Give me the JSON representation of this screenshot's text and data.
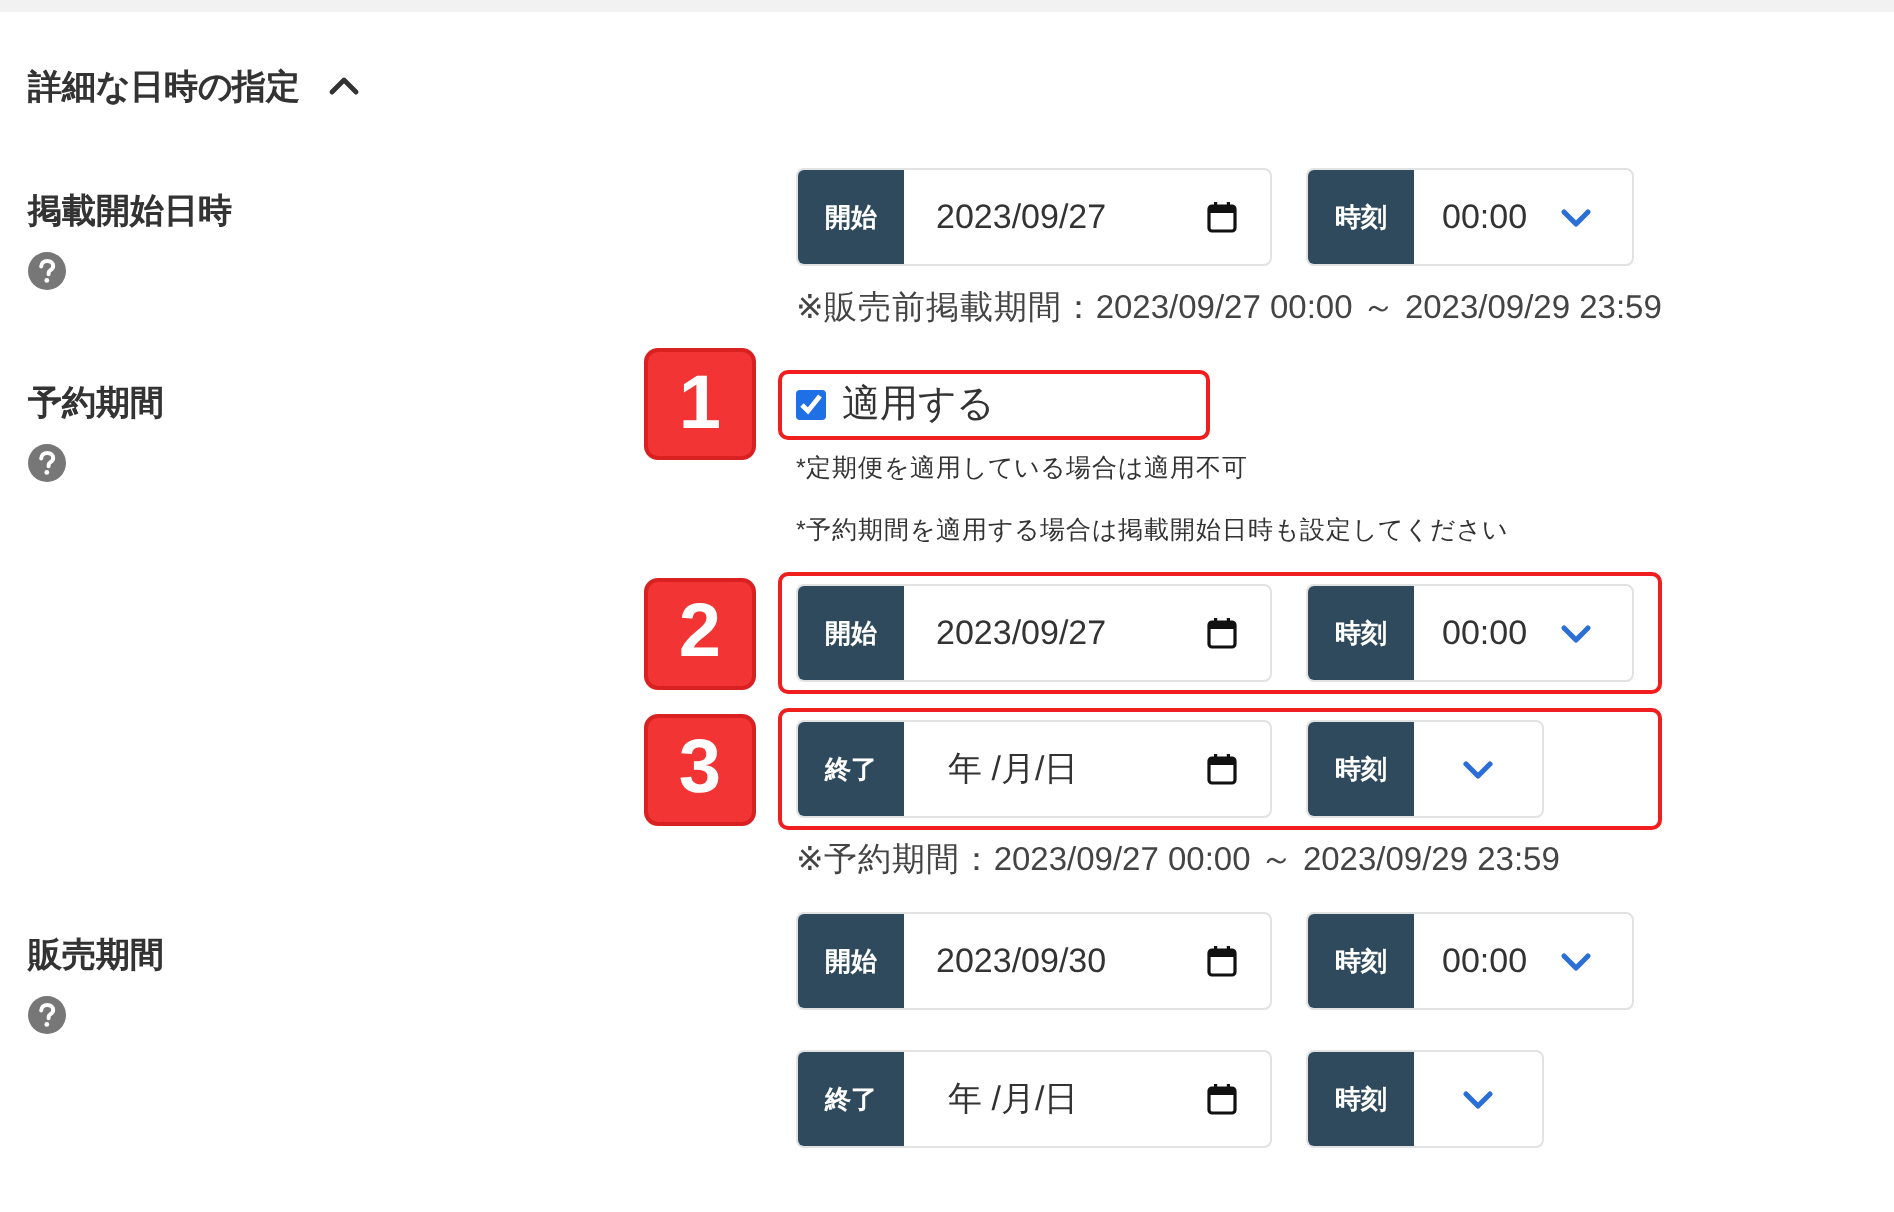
{
  "heading": {
    "text": "詳細な日時の指定",
    "expanded": true
  },
  "sections": [
    {
      "label": "掲載開始日時",
      "items": [
        {
          "kind": "datetime",
          "date_label": "開始",
          "date": "2023/09/27",
          "time_label": "時刻",
          "time": "00:00"
        },
        {
          "kind": "note",
          "text": "※販売前掲載期間：2023/09/27 00:00 ～ 2023/09/29 23:59"
        }
      ]
    },
    {
      "label": "予約期間",
      "items": [
        {
          "kind": "checkbox",
          "callout": "1",
          "label": "適用する",
          "checked": true
        },
        {
          "kind": "hint",
          "text": "*定期便を適用している場合は適用不可"
        },
        {
          "kind": "hint",
          "text": "*予約期間を適用する場合は掲載開始日時も設定してください"
        },
        {
          "kind": "datetime",
          "callout": "2",
          "date_label": "開始",
          "date": "2023/09/27",
          "time_label": "時刻",
          "time": "00:00"
        },
        {
          "kind": "datetime",
          "callout": "3",
          "date_label": "終了",
          "placeholder": "年 /月/日",
          "time_label": "時刻"
        },
        {
          "kind": "note",
          "text": "※予約期間：2023/09/27 00:00 ～ 2023/09/29 23:59"
        }
      ]
    },
    {
      "label": "販売期間",
      "items": [
        {
          "kind": "datetime",
          "date_label": "開始",
          "date": "2023/09/30",
          "time_label": "時刻",
          "time": "00:00"
        },
        {
          "kind": "datetime",
          "date_label": "終了",
          "placeholder": "年 /月/日",
          "time_label": "時刻"
        }
      ]
    }
  ]
}
